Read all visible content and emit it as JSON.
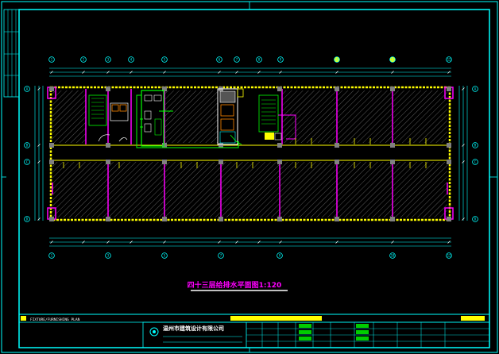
{
  "drawing": {
    "title": "四十三层给排水平面图1:120",
    "strip_label": "FIXTURE/FURNISHING PLAN",
    "company": "温州市建筑设计有限公司"
  },
  "colors": {
    "background": "#000000",
    "frame": "#00ffff",
    "walls": "#ffff00",
    "partitions": "#ff00ff",
    "plumbing": "#00ff00",
    "hatch": "#7f7f7f",
    "columns": "#808080"
  },
  "axes": {
    "top": [
      "1",
      "2",
      "3",
      "4",
      "5",
      "6",
      "7",
      "8",
      "9",
      "10",
      "11",
      "12"
    ],
    "bottom": [
      "1",
      "3",
      "5",
      "7",
      "9",
      "10",
      "12"
    ],
    "left": [
      "A",
      "B",
      "C",
      "D"
    ],
    "right": [
      "A",
      "B",
      "C",
      "D"
    ]
  }
}
